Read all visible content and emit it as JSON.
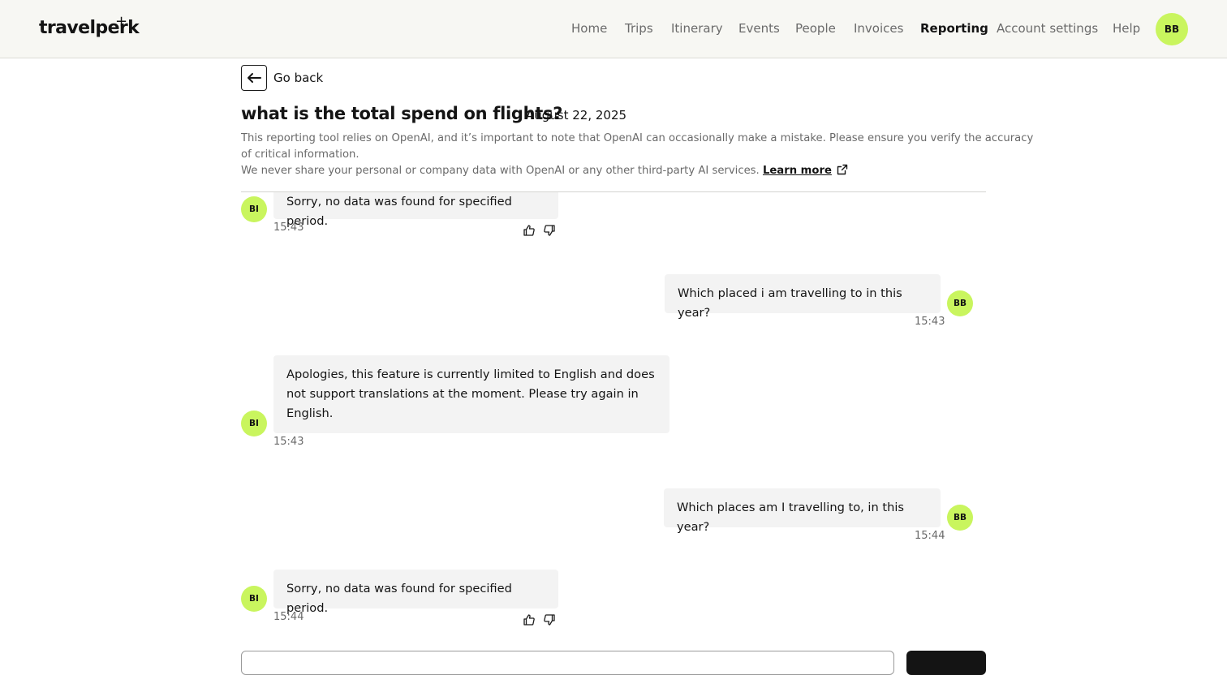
{
  "app": {
    "logo": "travelperk",
    "logo_plus": "+"
  },
  "nav": {
    "items": [
      "Home",
      "Trips",
      "Itinerary",
      "Events",
      "People",
      "Invoices",
      "Reporting",
      "Account settings",
      "Help"
    ],
    "active": "Reporting",
    "user_initials": "BB"
  },
  "page": {
    "back_label": "Go back",
    "title": "what is the total spend on flights?",
    "date": "August 22, 2025",
    "disclaimer_line1": "This reporting tool relies on OpenAI, and it’s important to note that OpenAI can occasionally make a mistake. Please ensure you verify the accuracy",
    "disclaimer_line2": "of critical information.",
    "disclaimer_line3": "We never share your personal or company data with OpenAI or any other third-party AI services.",
    "learn_more": "Learn more"
  },
  "messages": [
    {
      "sender": "bot",
      "initials": "BI",
      "text": "Sorry, no data was found for specified period.",
      "time": "15:43",
      "feedback": true
    },
    {
      "sender": "user",
      "initials": "BB",
      "text": "Which placed i am travelling to in this year?",
      "time": "15:43"
    },
    {
      "sender": "bot",
      "initials": "BI",
      "lines": [
        "Apologies, this feature is currently limited to English and does",
        "not support translations at the moment. Please try again in",
        "English."
      ],
      "time": "15:43"
    },
    {
      "sender": "user",
      "initials": "BB",
      "text": "Which places am I travelling to, in this year?",
      "time": "15:44"
    },
    {
      "sender": "bot",
      "initials": "BI",
      "text": "Sorry, no data was found for specified period.",
      "time": "15:44",
      "feedback": true
    }
  ],
  "colors": {
    "accent": "#c9f55e",
    "bubble": "#f3f3f3",
    "header_bg": "#f7f7f3",
    "text": "#141414"
  },
  "icons": {
    "back": "arrow-left-icon",
    "external": "external-link-icon",
    "like": "thumbs-up-icon",
    "dislike": "thumbs-down-icon"
  }
}
